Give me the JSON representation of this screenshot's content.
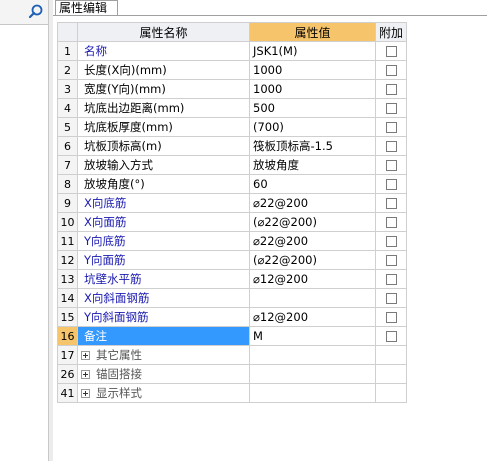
{
  "tab": {
    "title": "属性编辑"
  },
  "columns": {
    "name": "属性名称",
    "value": "属性值",
    "extra": "附加"
  },
  "rows": [
    {
      "num": "1",
      "name": "名称",
      "value": "JSK1(M)",
      "blue": true,
      "checked": false
    },
    {
      "num": "2",
      "name": "长度(X向)(mm)",
      "value": "1000",
      "blue": false,
      "checked": false
    },
    {
      "num": "3",
      "name": "宽度(Y向)(mm)",
      "value": "1000",
      "blue": false,
      "checked": false
    },
    {
      "num": "4",
      "name": "坑底出边距离(mm)",
      "value": "500",
      "blue": false,
      "checked": false
    },
    {
      "num": "5",
      "name": "坑底板厚度(mm)",
      "value": "(700)",
      "blue": false,
      "checked": false
    },
    {
      "num": "6",
      "name": "坑板顶标高(m)",
      "value": "筏板顶标高-1.5",
      "blue": false,
      "checked": false
    },
    {
      "num": "7",
      "name": "放坡输入方式",
      "value": "放坡角度",
      "blue": false,
      "checked": false
    },
    {
      "num": "8",
      "name": "放坡角度(°)",
      "value": "60",
      "blue": false,
      "checked": false
    },
    {
      "num": "9",
      "name": "X向底筋",
      "value": "⌀22@200",
      "blue": true,
      "checked": false
    },
    {
      "num": "10",
      "name": "X向面筋",
      "value": "(⌀22@200)",
      "blue": true,
      "checked": false
    },
    {
      "num": "11",
      "name": "Y向底筋",
      "value": "⌀22@200",
      "blue": true,
      "checked": false
    },
    {
      "num": "12",
      "name": "Y向面筋",
      "value": "(⌀22@200)",
      "blue": true,
      "checked": false
    },
    {
      "num": "13",
      "name": "坑壁水平筋",
      "value": "⌀12@200",
      "blue": true,
      "checked": false
    },
    {
      "num": "14",
      "name": "X向斜面钢筋",
      "value": "",
      "blue": true,
      "checked": false
    },
    {
      "num": "15",
      "name": "Y向斜面钢筋",
      "value": "⌀12@200",
      "blue": true,
      "checked": false
    },
    {
      "num": "16",
      "name": "备注",
      "value": "M",
      "blue": false,
      "checked": false,
      "selected": true
    }
  ],
  "groups": [
    {
      "num": "17",
      "name": "其它属性"
    },
    {
      "num": "26",
      "name": "锚固搭接"
    },
    {
      "num": "41",
      "name": "显示样式"
    }
  ]
}
